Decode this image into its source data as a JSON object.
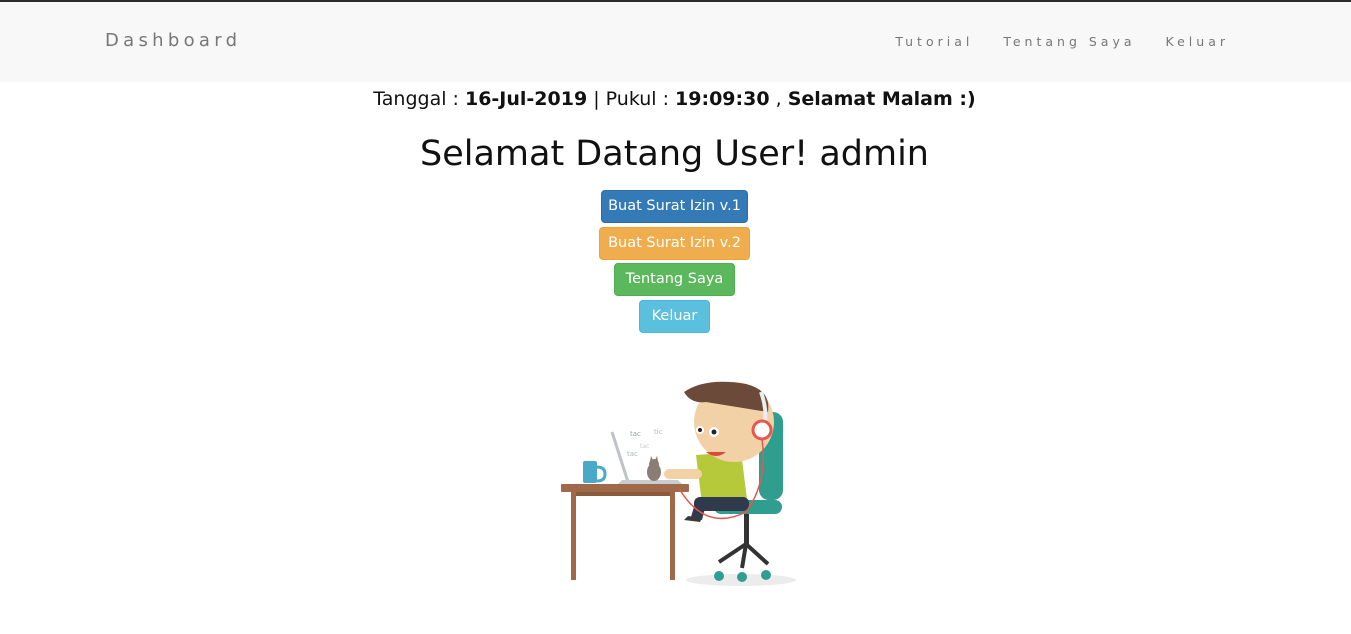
{
  "navbar": {
    "brand": "Dashboard",
    "links": [
      {
        "label": "Tutorial"
      },
      {
        "label": "Tentang Saya"
      },
      {
        "label": "Keluar"
      }
    ]
  },
  "datetime": {
    "date_label": "Tanggal : ",
    "date_value": "16-Jul-2019",
    "separator": " | Pukul : ",
    "time_value": "19:09:30",
    "comma": " , ",
    "greeting": "Selamat Malam :)"
  },
  "welcome": {
    "title": "Selamat Datang User! admin"
  },
  "actions": {
    "buat_v1": "Buat Surat Izin v.1",
    "buat_v2": "Buat Surat Izin v.2",
    "tentang": "Tentang Saya",
    "keluar": "Keluar"
  },
  "illustration": {
    "sounds": [
      "tac",
      "tic",
      "tac",
      "tac"
    ]
  },
  "colors": {
    "primary": "#337ab7",
    "warning": "#f0ad4e",
    "success": "#5cb85c",
    "info": "#5bc0de",
    "navbar_bg": "#f8f8f8"
  }
}
